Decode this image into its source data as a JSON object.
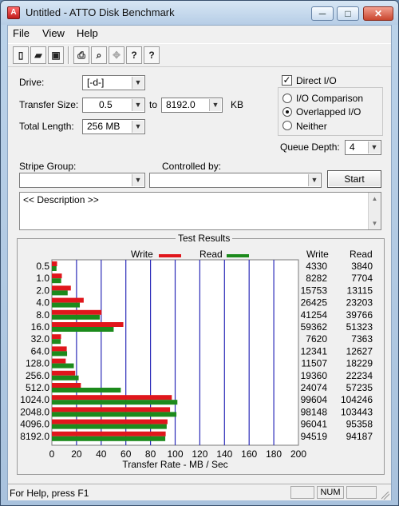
{
  "window": {
    "title": "Untitled - ATTO Disk Benchmark",
    "controls": [
      "─",
      "□",
      "✕"
    ]
  },
  "menu": [
    "File",
    "View",
    "Help"
  ],
  "toolbar": {
    "buttons": [
      {
        "name": "new-icon",
        "glyph": "▯"
      },
      {
        "name": "open-folder-icon",
        "glyph": "▰"
      },
      {
        "name": "save-icon",
        "glyph": "▣"
      },
      {
        "name": "print-icon",
        "glyph": "⎙"
      },
      {
        "name": "print-preview-icon",
        "glyph": "⌕"
      },
      {
        "name": "move-icon",
        "glyph": "✥"
      },
      {
        "name": "help-icon",
        "glyph": "?"
      },
      {
        "name": "context-help-icon",
        "glyph": "?"
      }
    ]
  },
  "form": {
    "drive_label": "Drive:",
    "drive_value": "[-d-]",
    "transfer_size_label": "Transfer Size:",
    "transfer_from": "0.5",
    "to_label": "to",
    "transfer_to": "8192.0",
    "kb_label": "KB",
    "total_length_label": "Total Length:",
    "total_length_value": "256 MB",
    "direct_io_label": "Direct I/O",
    "io_comparison_label": "I/O Comparison",
    "overlapped_io_label": "Overlapped I/O",
    "neither_label": "Neither",
    "queue_depth_label": "Queue Depth:",
    "queue_depth_value": "4",
    "stripe_group_label": "Stripe Group:",
    "controlled_by_label": "Controlled by:",
    "start_label": "Start",
    "description": "<< Description >>"
  },
  "results": {
    "title": "Test Results",
    "write_label": "Write",
    "read_label": "Read",
    "write_col": "Write",
    "read_col": "Read"
  },
  "chart_data": {
    "type": "bar",
    "orientation": "horizontal",
    "categories": [
      "0.5",
      "1.0",
      "2.0",
      "4.0",
      "8.0",
      "16.0",
      "32.0",
      "64.0",
      "128.0",
      "256.0",
      "512.0",
      "1024.0",
      "2048.0",
      "4096.0",
      "8192.0"
    ],
    "series": [
      {
        "name": "Write",
        "color": "#e0161c",
        "values": [
          4330,
          8282,
          15753,
          26425,
          41254,
          59362,
          7620,
          12341,
          11507,
          19360,
          24074,
          99604,
          98148,
          96041,
          94519
        ]
      },
      {
        "name": "Read",
        "color": "#1c8a1c",
        "values": [
          3840,
          7704,
          13115,
          23203,
          39766,
          51323,
          7363,
          12627,
          18229,
          22234,
          57235,
          104246,
          103443,
          95358,
          94187
        ]
      }
    ],
    "write_text": [
      "4330",
      "8282",
      "15753",
      "26425",
      "41254",
      "59362",
      "7620",
      "12341",
      "11507",
      "19360",
      "24074",
      "99604",
      "98148",
      "96041",
      "94519"
    ],
    "read_text": [
      "3840",
      "7704",
      "13115",
      "23203",
      "39766",
      "51323",
      "7363",
      "12627",
      "18229",
      "22234",
      "57235",
      "104246",
      "103443",
      "95358",
      "94187"
    ],
    "xlabel": "Transfer Rate - MB / Sec",
    "xlim": [
      0,
      200
    ],
    "xticks": [
      "0",
      "20",
      "40",
      "60",
      "80",
      "100",
      "120",
      "140",
      "160",
      "180",
      "200"
    ],
    "grid": true,
    "legend": "top-center"
  },
  "status": {
    "text": "For Help, press F1",
    "num": "NUM"
  }
}
